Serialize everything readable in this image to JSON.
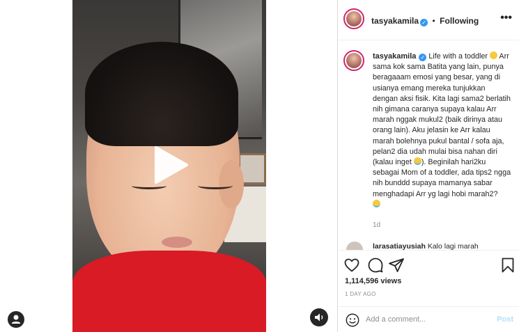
{
  "post": {
    "username": "tasyakamila",
    "follow_separator": "•",
    "follow_status": "Following",
    "more_icon": "more-horizontal-icon"
  },
  "caption": {
    "username": "tasyakamila",
    "line_1": "Life with a toddler",
    "body_1": "Arr sama kok sama Batita yang lain, punya beragaaam emosi yang besar, yang di usianya emang mereka tunjukkan dengan aksi fisik. Kita lagi sama2 berlatih nih gimana caranya supaya kalau Arr marah nggak mukul2 (baik dirinya atau orang lain). Aku jelasin ke Arr kalau marah bolehnya pukul bantal / sofa aja, pelan2 dia udah mulai bisa nahan diri (kalau inget",
    "body_2": "). Beginilah hari2ku sebagai Mom of a toddler, ada tips2 ngga nih bunddd supaya mamanya sabar menghadapi Arr yg lagi hobi marah2?",
    "time": "1d"
  },
  "comment": {
    "username": "larasatiayusiah",
    "text": "Kalo lagi marah"
  },
  "stats": {
    "views": "1,114,596 views",
    "posted": "1 DAY AGO"
  },
  "add_comment": {
    "placeholder": "Add a comment...",
    "post_label": "Post"
  },
  "colors": {
    "verified": "#3897f0",
    "story_ring": "#d3216e",
    "post_disabled": "#b2dffc",
    "shirt": "#d81b25"
  }
}
